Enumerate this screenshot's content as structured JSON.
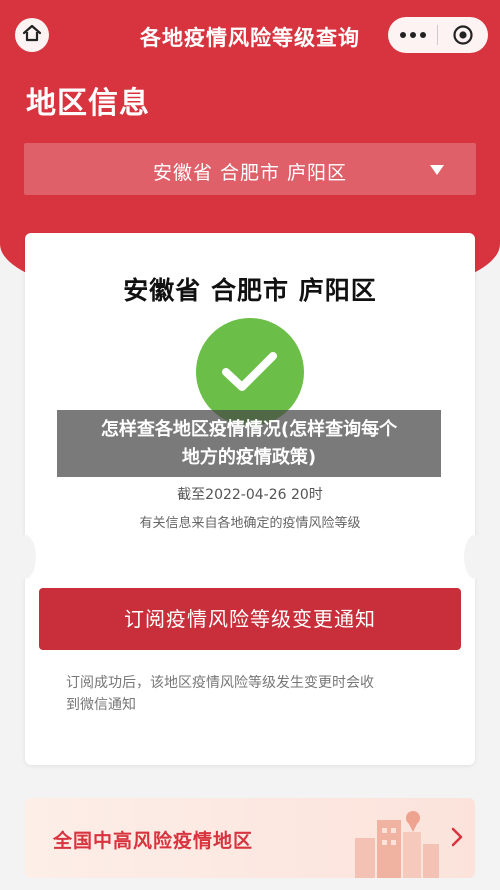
{
  "nav": {
    "title": "各地疫情风险等级查询",
    "home_icon": "home-icon",
    "more_icon": "more-dots-icon",
    "close_icon": "target-circle-icon"
  },
  "header": {
    "section_title": "地区信息",
    "selector_value": "安徽省 合肥市 庐阳区",
    "dropdown_icon": "caret-down-icon"
  },
  "result_card": {
    "region": "安徽省 合肥市 庐阳区",
    "status_icon": "check-icon",
    "status_color": "#6bbf48",
    "as_of": "截至2022-04-26 20时",
    "source_note": "有关信息来自各地确定的疫情风险等级"
  },
  "overlay": {
    "line1": "怎样查各地区疫情情况(怎样查询每个",
    "line2": "地方的疫情政策)"
  },
  "subscribe": {
    "button_label": "订阅疫情风险等级变更通知",
    "notice_line1": "订阅成功后，该地区疫情风险等级发生变更时会收",
    "notice_line2": "到微信通知"
  },
  "bottom": {
    "label": "全国中高风险疫情地区",
    "chevron_icon": "chevron-right-icon"
  },
  "colors": {
    "brand_red": "#d8343f",
    "button_red": "#c82f3a",
    "success_green": "#6bbf48"
  }
}
